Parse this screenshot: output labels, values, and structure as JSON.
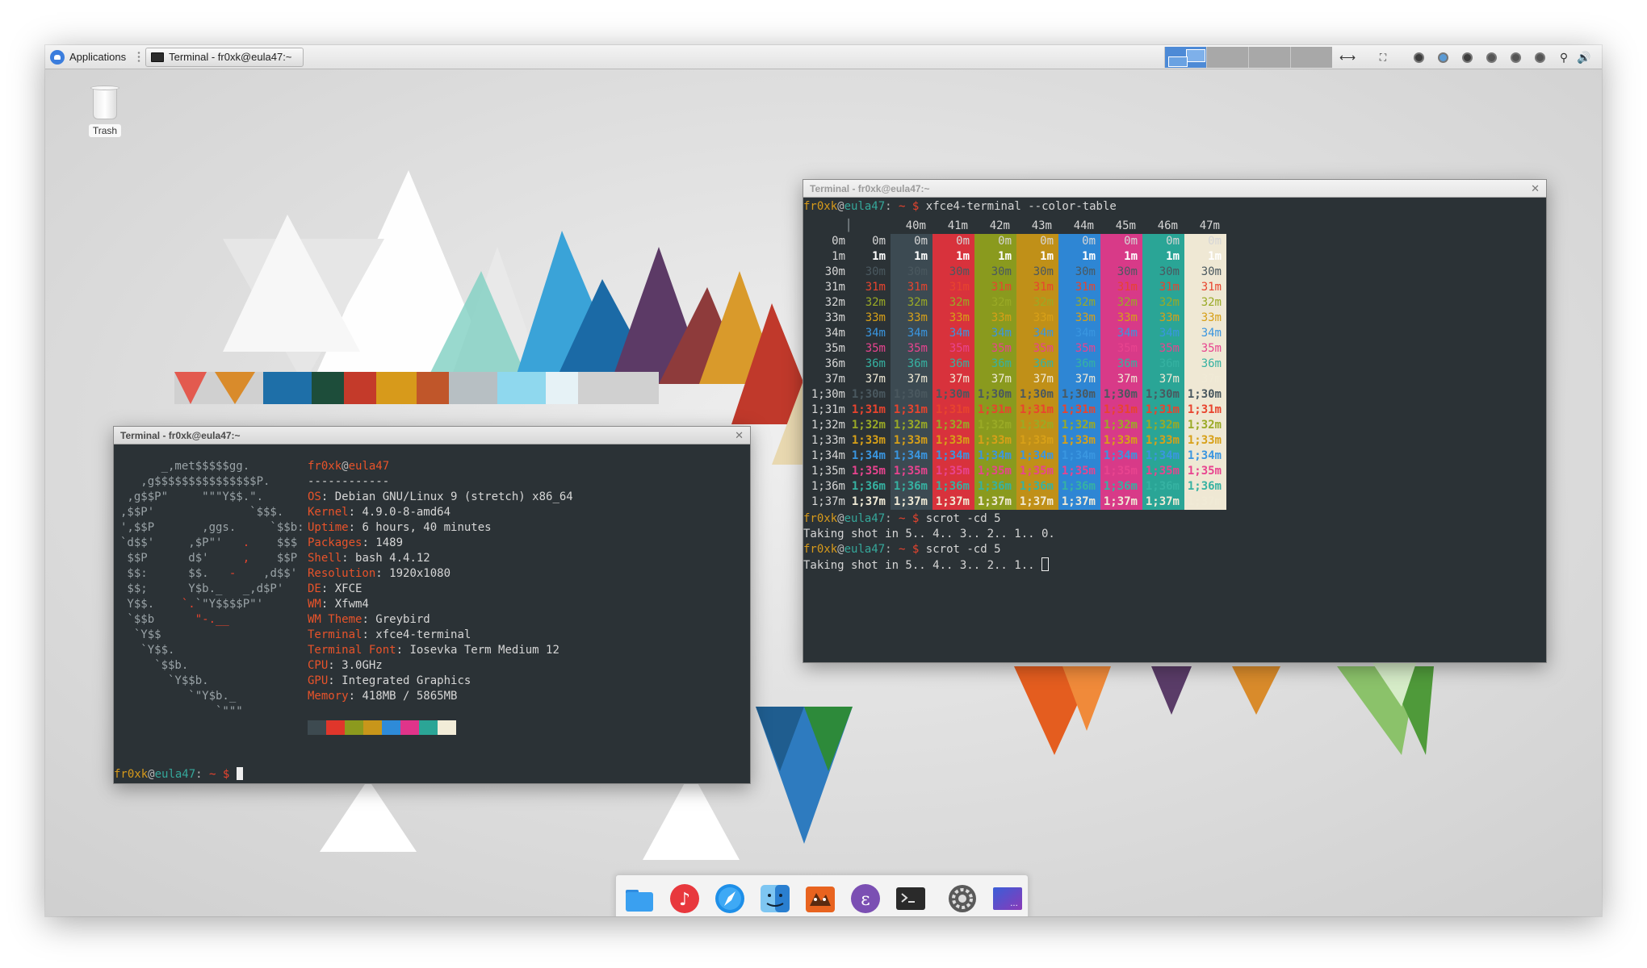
{
  "top_panel": {
    "applications_label": "Applications",
    "task_label": "Terminal - fr0xk@eula47:~"
  },
  "desktop": {
    "trash_label": "Trash"
  },
  "neofetch_window": {
    "title": "Terminal - fr0xk@eula47:~",
    "user": "fr0xk",
    "host": "eula47",
    "separator": "------------",
    "info": [
      {
        "key": "OS",
        "value": "Debian GNU/Linux 9 (stretch) x86_64"
      },
      {
        "key": "Kernel",
        "value": "4.9.0-8-amd64"
      },
      {
        "key": "Uptime",
        "value": "6 hours, 40 minutes"
      },
      {
        "key": "Packages",
        "value": "1489"
      },
      {
        "key": "Shell",
        "value": "bash 4.4.12"
      },
      {
        "key": "Resolution",
        "value": "1920x1080"
      },
      {
        "key": "DE",
        "value": "XFCE"
      },
      {
        "key": "WM",
        "value": "Xfwm4"
      },
      {
        "key": "WM Theme",
        "value": "Greybird"
      },
      {
        "key": "Terminal",
        "value": "xfce4-terminal"
      },
      {
        "key": "Terminal Font",
        "value": "Iosevka Term Medium 12"
      },
      {
        "key": "CPU",
        "value": "3.0GHz"
      },
      {
        "key": "GPU",
        "value": "Integrated Graphics"
      },
      {
        "key": "Memory",
        "value": "418MB / 5865MB"
      }
    ],
    "palette_colors": [
      "#3d4a50",
      "#e0362b",
      "#8c9a1e",
      "#c8961a",
      "#2e8bd8",
      "#e0348a",
      "#2ba596",
      "#f2ecd8"
    ],
    "prompt_path": "~",
    "prompt_symbol": "$"
  },
  "colortable_window": {
    "title": "Terminal - fr0xk@eula47:~",
    "command": "xfce4-terminal --color-table",
    "bg_headers": [
      "40m",
      "41m",
      "42m",
      "43m",
      "44m",
      "45m",
      "46m",
      "47m"
    ],
    "rows": [
      "0m",
      "1m",
      "30m",
      "31m",
      "32m",
      "33m",
      "34m",
      "35m",
      "36m",
      "37m",
      "1;30m",
      "1;31m",
      "1;32m",
      "1;33m",
      "1;34m",
      "1;35m",
      "1;36m",
      "1;37m"
    ],
    "commands": [
      {
        "cmd": "scrot -cd 5",
        "output": "Taking shot in 5.. 4.. 3.. 2.. 1.. 0."
      },
      {
        "cmd": "scrot -cd 5",
        "output": "Taking shot in 5.. 4.. 3.. 2.. 1.. "
      }
    ]
  }
}
